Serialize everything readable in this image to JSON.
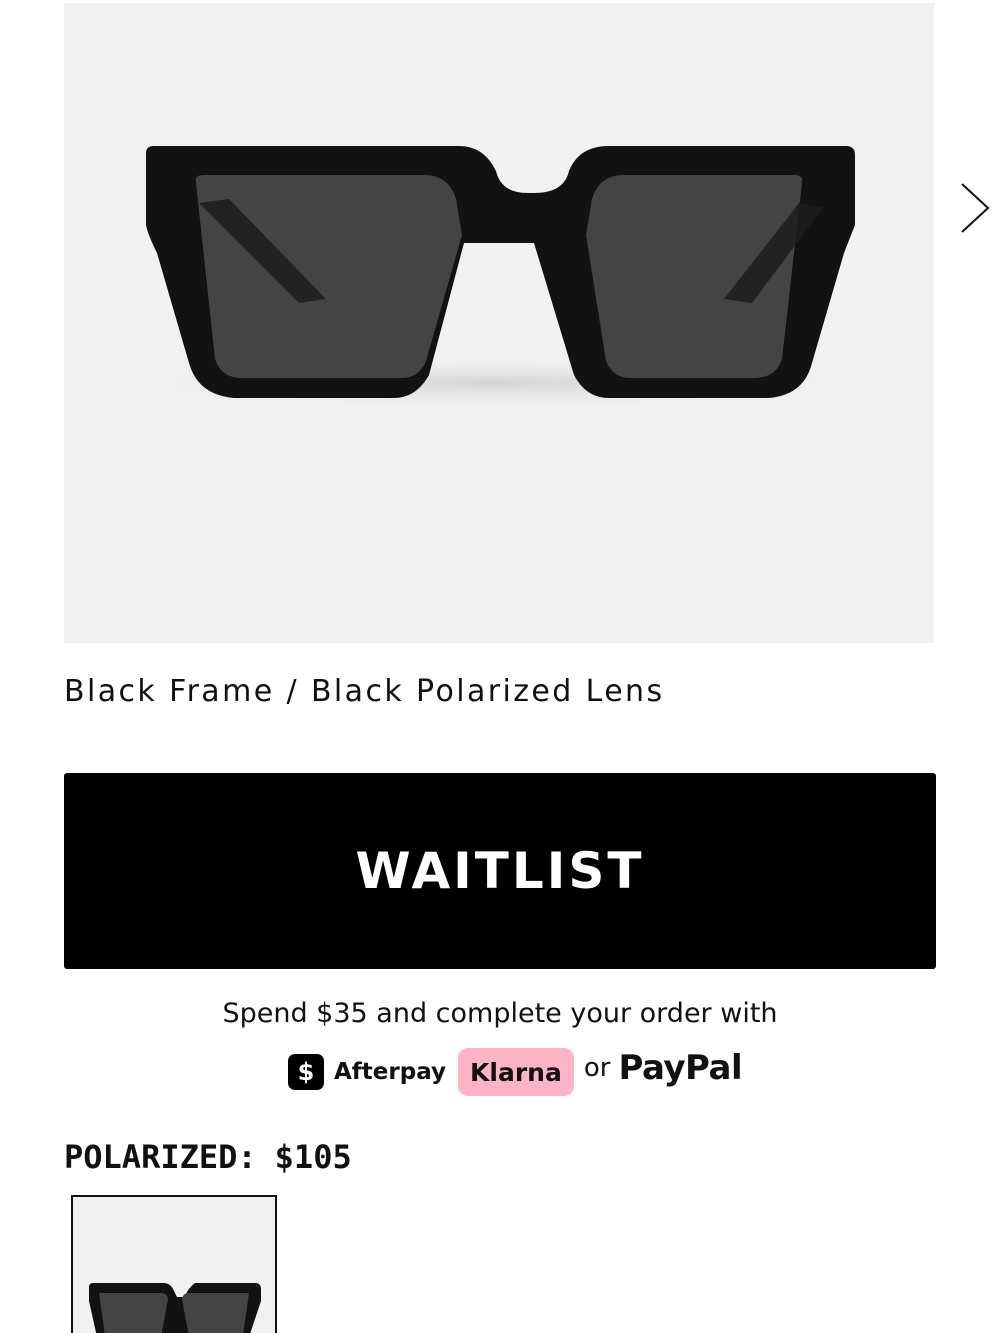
{
  "product": {
    "variant_name": "Black Frame / Black Polarized Lens",
    "image_icon": "sunglasses-image",
    "frame_color": "#121212",
    "lens_color": "#444444",
    "image_background": "#f1f1f1"
  },
  "carousel": {
    "next_icon": "chevron-right-icon"
  },
  "cta": {
    "label": "WAITLIST",
    "background": "#000000",
    "text_color": "#ffffff"
  },
  "payment": {
    "message": "Spend $35 and complete your order with",
    "afterpay_symbol": "$",
    "afterpay_label": "Afterpay",
    "klarna_label": "Klarna",
    "klarna_color": "#ffb3c7",
    "or_label": "or",
    "paypal_label": "PayPal"
  },
  "pricing": {
    "label": "POLARIZED:",
    "price": "$105"
  },
  "thumbnails": [
    {
      "name": "Black Frame / Black Polarized Lens",
      "selected": true
    }
  ]
}
